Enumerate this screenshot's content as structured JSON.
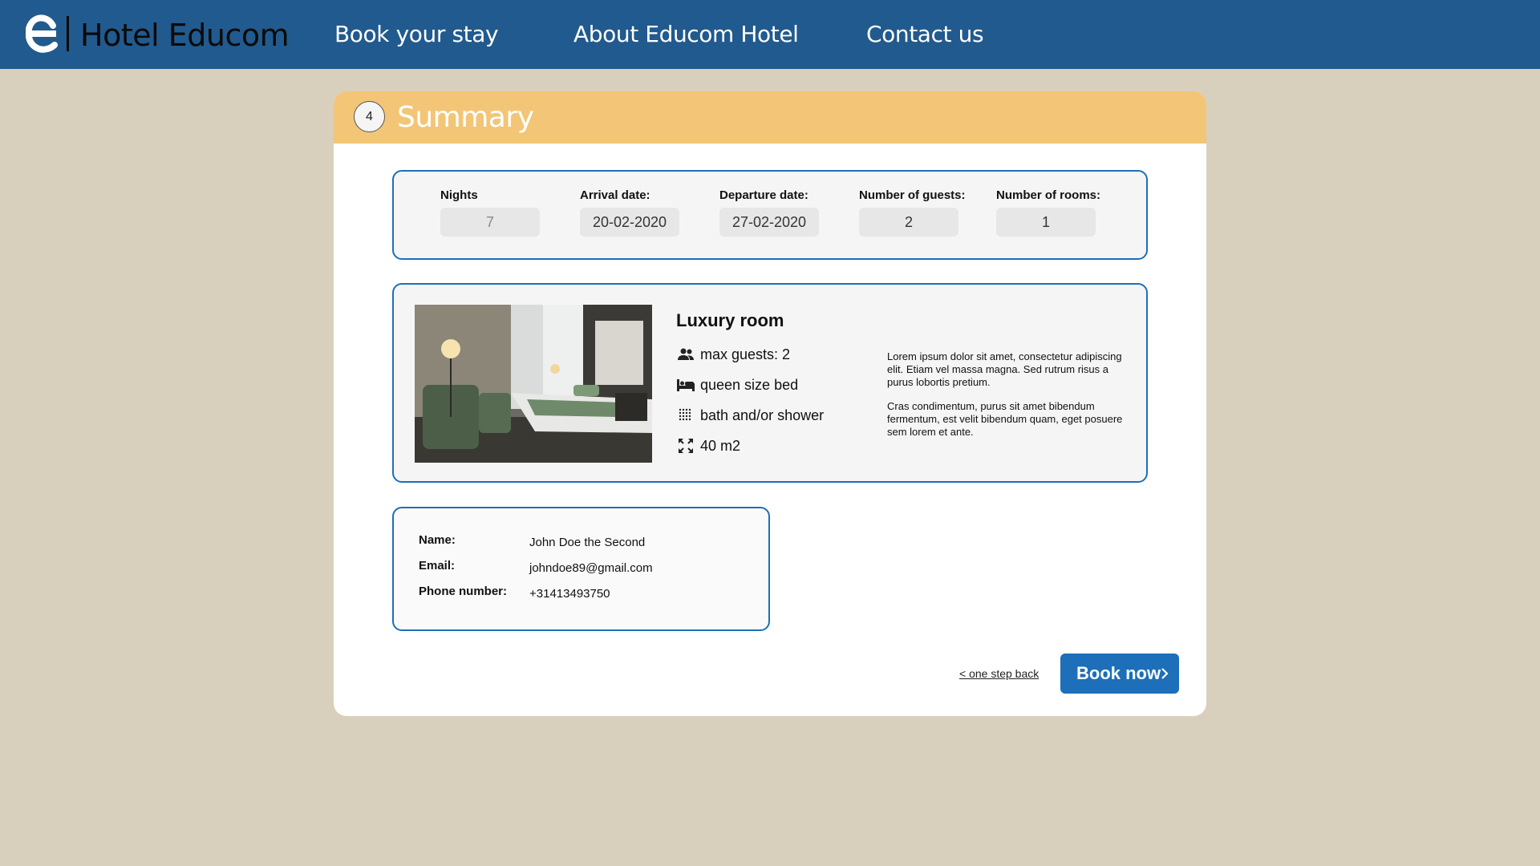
{
  "header": {
    "brand": "Hotel Educom",
    "nav": [
      "Book your stay",
      "About Educom Hotel",
      "Contact us"
    ],
    "background": "#215a8e"
  },
  "summary": {
    "step": "4",
    "title": "Summary",
    "header_color": "#f2c676",
    "fields": [
      {
        "label": "Nights",
        "value": "7"
      },
      {
        "label": "Arrival date:",
        "value": "20-02-2020"
      },
      {
        "label": "Departure date:",
        "value": "27-02-2020"
      },
      {
        "label": "Number of guests:",
        "value": "2"
      },
      {
        "label": "Number of rooms:",
        "value": "1"
      }
    ]
  },
  "room": {
    "title": "Luxury room",
    "features": [
      {
        "icon": "people-icon",
        "text": "max guests: 2"
      },
      {
        "icon": "bed-icon",
        "text": "queen size bed"
      },
      {
        "icon": "shower-icon",
        "text": "bath and/or shower"
      },
      {
        "icon": "expand-icon",
        "text": "40 m2"
      }
    ],
    "description": [
      "Lorem ipsum dolor sit amet, consectetur adipiscing elit. Etiam vel massa magna. Sed rutrum risus a purus lobortis pretium.",
      "Cras condimentum, purus sit amet bibendum fermentum, est velit bibendum quam, eget posuere sem lorem et ante."
    ]
  },
  "contact": {
    "rows": [
      {
        "label": "Name:",
        "value": "John Doe the Second"
      },
      {
        "label": "Email:",
        "value": "johndoe89@gmail.com"
      },
      {
        "label": "Phone number:",
        "value": "+31413493750"
      }
    ]
  },
  "actions": {
    "back": "< one step back",
    "book": "Book now",
    "accent": "#1c6fb8"
  }
}
